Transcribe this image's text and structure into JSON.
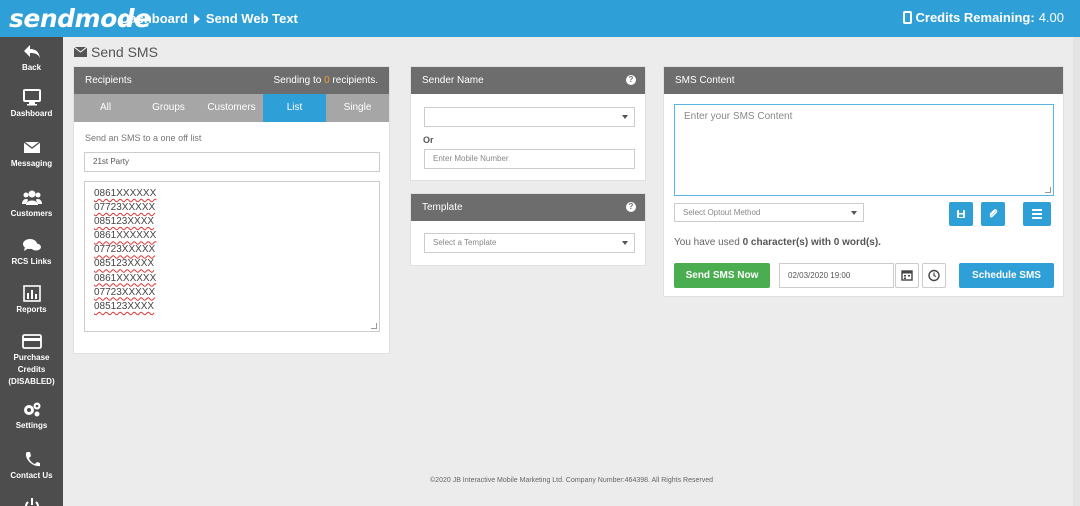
{
  "header": {
    "logo": "sendmode",
    "crumb_dashboard": "Dashboard",
    "crumb_current": "Send Web Text",
    "credits_label": "Credits Remaining:",
    "credits_value": "4.00"
  },
  "sidebar": {
    "items": [
      {
        "label": "Back",
        "icon": "back-arrow-icon"
      },
      {
        "label": "Dashboard",
        "icon": "monitor-icon"
      },
      {
        "label": "Messaging",
        "icon": "envelope-icon"
      },
      {
        "label": "Customers",
        "icon": "users-icon"
      },
      {
        "label": "RCS Links",
        "icon": "chat-bubbles-icon"
      },
      {
        "label": "Reports",
        "icon": "bar-chart-icon"
      },
      {
        "label": "Purchase Credits (DISABLED)",
        "icon": "credit-card-icon"
      },
      {
        "label": "Settings",
        "icon": "gears-icon"
      },
      {
        "label": "Contact Us",
        "icon": "phone-icon"
      }
    ]
  },
  "page_title": "Send SMS",
  "recipients": {
    "title": "Recipients",
    "sending_prefix": "Sending to",
    "sending_count": "0",
    "sending_suffix": "recipients.",
    "tabs": [
      "All",
      "Groups",
      "Customers",
      "List",
      "Single"
    ],
    "active_tab": "List",
    "instruction": "Send an SMS to a one off list",
    "list_name": "21st Party",
    "numbers": [
      "0861XXXXXX",
      "07723XXXXX",
      "085123XXXX",
      "0861XXXXXX",
      "07723XXXXX",
      "085123XXXX",
      "0861XXXXXX",
      "07723XXXXX",
      "085123XXXX"
    ]
  },
  "sender": {
    "title": "Sender Name",
    "select_value": "",
    "or_label": "Or",
    "mobile_placeholder": "Enter Mobile Number"
  },
  "template": {
    "title": "Template",
    "select_placeholder": "Select a Template"
  },
  "sms": {
    "title": "SMS Content",
    "content_placeholder": "Enter your SMS Content",
    "optout_placeholder": "Select Optout Method",
    "usage_prefix": "You have used",
    "usage_chars": "0 character(s) with 0 word(s).",
    "send_now": "Send SMS Now",
    "schedule_datetime": "02/03/2020 19:00",
    "schedule": "Schedule SMS"
  },
  "footer": "©2020 JB Interactive Mobile Marketing Ltd. Company Number:464398. All Rights Reserved",
  "colors": {
    "accent": "#2f9fd8",
    "sidebar": "#4d4d4d",
    "panel_header": "#6d6d6d",
    "success": "#4aae50",
    "highlight": "#f0a030"
  }
}
